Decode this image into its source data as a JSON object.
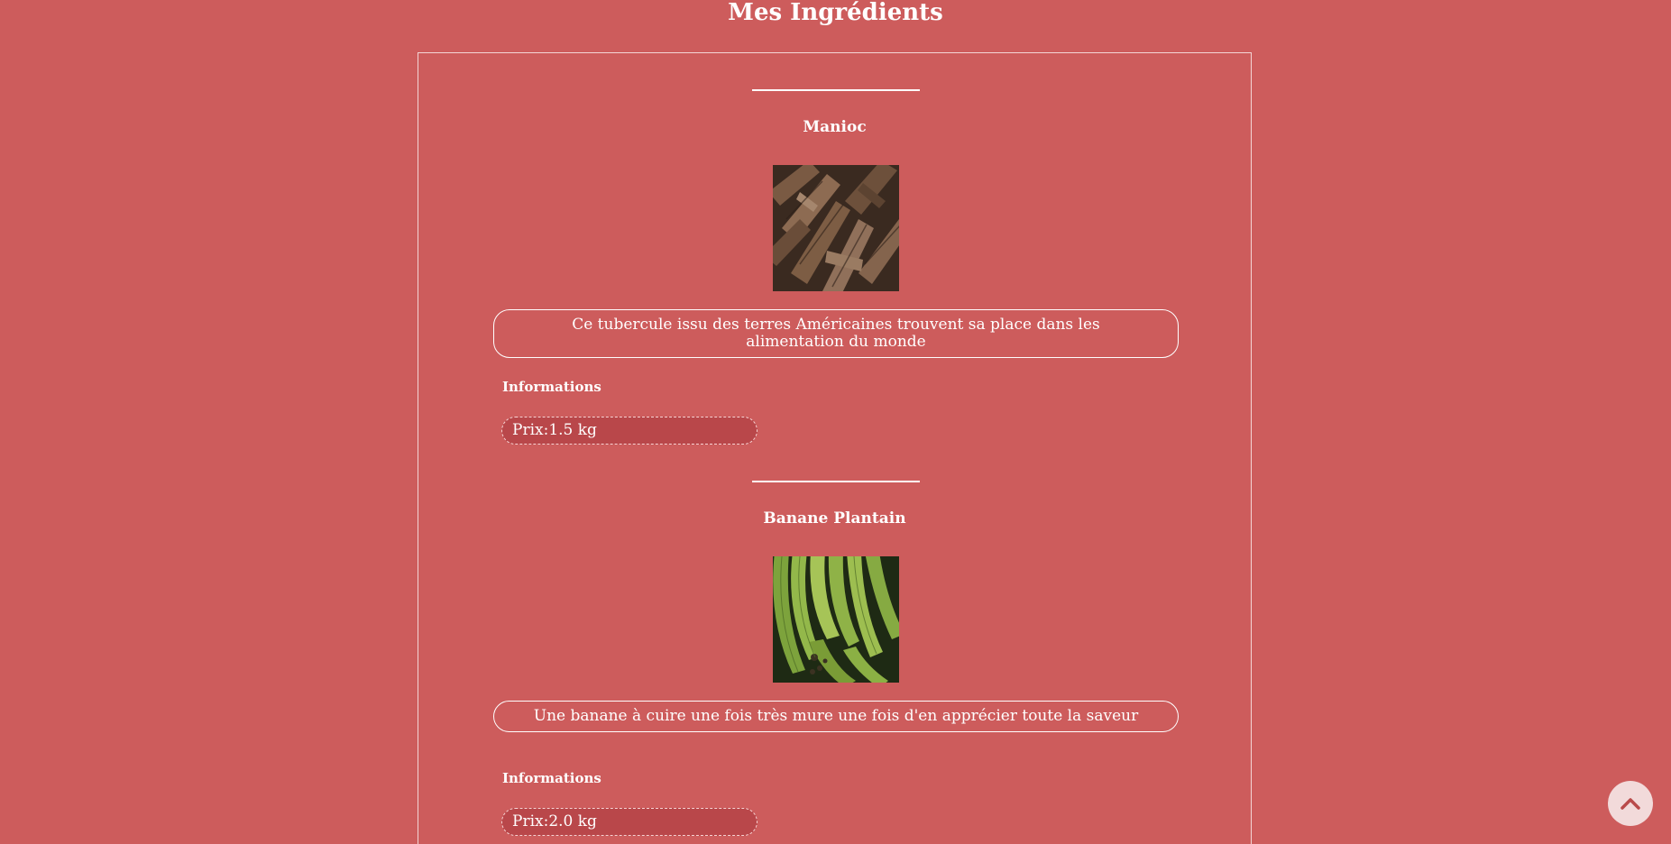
{
  "page": {
    "title": "Mes Ingrédients"
  },
  "ingredients": [
    {
      "name": "Manioc",
      "description": "Ce tubercule issu des terres Américaines trouvent sa place dans les alimentation du monde",
      "info_label": "Informations",
      "price": "Prix:1.5 kg",
      "image": "cassava-roots-photo"
    },
    {
      "name": "Banane Plantain",
      "description": "Une banane à cuire une fois très mure une fois d'en apprécier toute la saveur",
      "info_label": "Informations",
      "price": "Prix:2.0 kg",
      "image": "plantain-bananas-photo"
    }
  ],
  "scroll_top": {
    "icon": "chevron-up-icon"
  },
  "colors": {
    "background": "#cd5c5c",
    "pill": "#b9474a",
    "text": "#ffffff",
    "scroll_button": "#f2dada",
    "chevron": "#b94a4a"
  }
}
